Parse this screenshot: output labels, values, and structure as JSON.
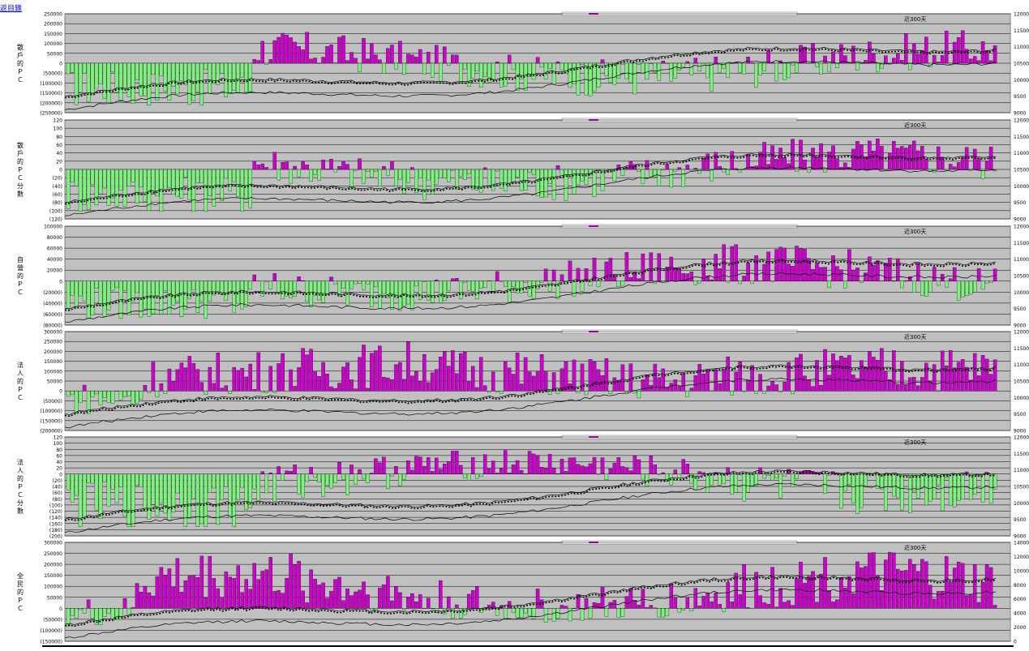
{
  "page": {
    "back_link": "返目錄"
  },
  "colors": {
    "plot_bg": "#c0c0c0",
    "positive": "#cc00cc",
    "negative": "#80f080",
    "line": "#000000"
  },
  "chart_data": [
    {
      "type": "bar",
      "id": "p1",
      "panel_label": "散戶的ＰＣ",
      "annotation": "近300天",
      "left_ticks": [
        "250000",
        "200000",
        "150000",
        "100000",
        "50000",
        "0",
        "(50000)",
        "(100000)",
        "(150000)",
        "(200000)",
        "(250000)"
      ],
      "right_ticks": [
        "12000",
        "11500",
        "11000",
        "10500",
        "10000",
        "9500",
        "9000"
      ],
      "ylim": [
        -250000,
        250000
      ],
      "right_ylim": [
        9000,
        12000
      ]
    },
    {
      "type": "bar",
      "id": "p2",
      "panel_label": "散戶的ＰＣ分數",
      "annotation": "近300天",
      "left_ticks": [
        "120",
        "100",
        "80",
        "60",
        "40",
        "20",
        "0",
        "(20)",
        "(40)",
        "(60)",
        "(80)",
        "(100)",
        "(120)"
      ],
      "right_ticks": [
        "12000",
        "11500",
        "11000",
        "10500",
        "10000",
        "9500",
        "9000"
      ],
      "ylim": [
        -120,
        120
      ],
      "right_ylim": [
        9000,
        12000
      ]
    },
    {
      "type": "bar",
      "id": "p3",
      "panel_label": "自營的ＰＣ",
      "annotation": "近300天",
      "left_ticks": [
        "100000",
        "80000",
        "60000",
        "40000",
        "20000",
        "0",
        "(20000)",
        "(40000)",
        "(60000)",
        "(80000)"
      ],
      "right_ticks": [
        "12000",
        "11500",
        "11000",
        "10500",
        "10000",
        "9500",
        "9000"
      ],
      "ylim": [
        -80000,
        100000
      ],
      "right_ylim": [
        9000,
        12000
      ]
    },
    {
      "type": "bar",
      "id": "p4",
      "panel_label": "法人的ＰＣ",
      "annotation": "近300天",
      "left_ticks": [
        "300000",
        "250000",
        "200000",
        "150000",
        "100000",
        "50000",
        "0",
        "(50000)",
        "(100000)",
        "(150000)",
        "(200000)"
      ],
      "right_ticks": [
        "12000",
        "11500",
        "11000",
        "10500",
        "10000",
        "9500",
        "9000"
      ],
      "ylim": [
        -200000,
        300000
      ],
      "right_ylim": [
        9000,
        12000
      ]
    },
    {
      "type": "bar",
      "id": "p5",
      "panel_label": "法人的ＰＣ分數",
      "annotation": "近300天",
      "left_ticks": [
        "120",
        "100",
        "80",
        "60",
        "40",
        "20",
        "0",
        "(20)",
        "(40)",
        "(60)",
        "(80)",
        "(100)",
        "(120)",
        "(140)",
        "(160)",
        "(180)",
        "(200)"
      ],
      "right_ticks": [
        "12000",
        "11500",
        "11000",
        "10500",
        "10000",
        "9500",
        "9000"
      ],
      "ylim": [
        -200,
        120
      ],
      "right_ylim": [
        9000,
        12000
      ]
    },
    {
      "type": "bar",
      "id": "p6",
      "panel_label": "全民的ＰＣ",
      "annotation": "近300天",
      "left_ticks": [
        "300000",
        "250000",
        "200000",
        "150000",
        "100000",
        "50000",
        "0",
        "(50000)",
        "(100000)",
        "(150000)"
      ],
      "right_ticks": [
        "14000",
        "12000",
        "10000",
        "8000",
        "6000",
        "4000",
        "2000",
        "0"
      ],
      "ylim": [
        -150000,
        300000
      ],
      "right_ylim": [
        0,
        14000
      ]
    }
  ]
}
